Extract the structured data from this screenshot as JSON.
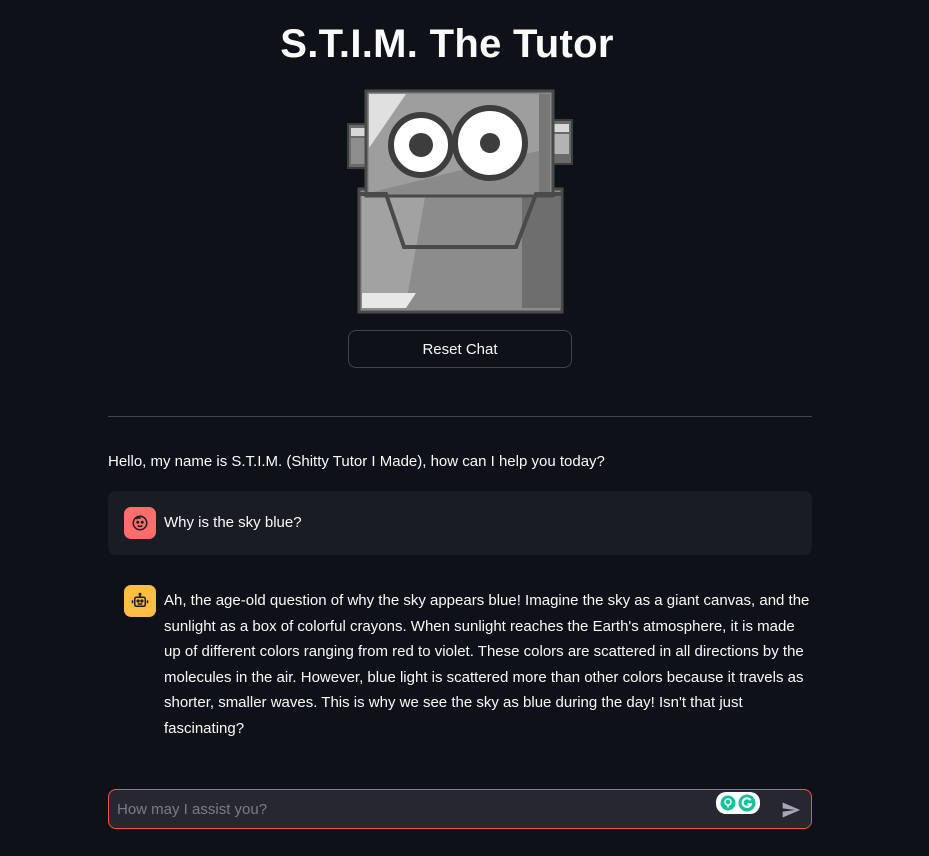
{
  "page": {
    "title": "S.T.I.M. The Tutor"
  },
  "header": {
    "reset_label": "Reset Chat"
  },
  "chat": {
    "greeting": "Hello, my name is S.T.I.M. (Shitty Tutor I Made), how can I help you today?",
    "messages": [
      {
        "role": "user",
        "avatar_icon": "user-face-icon",
        "text": "Why is the sky blue?"
      },
      {
        "role": "assistant",
        "avatar_icon": "robot-icon",
        "text": "Ah, the age-old question of why the sky appears blue! Imagine the sky as a giant canvas, and the sunlight as a box of colorful crayons. When sunlight reaches the Earth's atmosphere, it is made up of different colors ranging from red to violet. These colors are scattered in all directions by the molecules in the air. However, blue light is scattered more than other colors because it travels as shorter, smaller waves. This is why we see the sky as blue during the day! Isn't that just fascinating?"
      }
    ]
  },
  "input": {
    "placeholder": "How may I assist you?",
    "value": ""
  },
  "colors": {
    "background": "#0e1117",
    "user_avatar": "#ff6c6c",
    "bot_avatar": "#ffbd45",
    "input_border_focus": "#ff4b4b",
    "grammarly": "#15c39a"
  }
}
